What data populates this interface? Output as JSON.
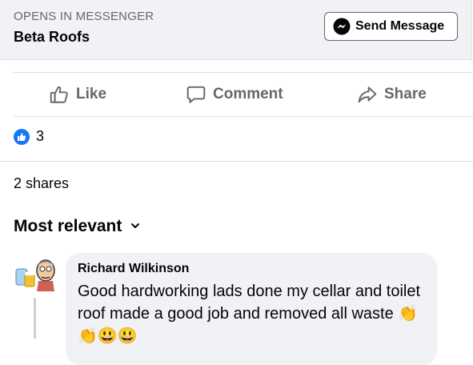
{
  "ad": {
    "opens_in": "OPENS IN MESSENGER",
    "page_name": "Beta Roofs",
    "send_label": "Send Message"
  },
  "actions": {
    "like": "Like",
    "comment": "Comment",
    "share": "Share"
  },
  "reactions": {
    "count": "3"
  },
  "shares": {
    "text": "2 shares"
  },
  "sort": {
    "label": "Most relevant"
  },
  "comment": {
    "author": "Richard Wilkinson",
    "text": "Good hardworking lads done my cellar and toilet roof made a good job and removed all waste 👏👏😃😃"
  },
  "colors": {
    "accent": "#1877f2",
    "muted": "#65676b",
    "bubble": "#f0f2f5"
  },
  "icons": [
    "messenger-icon",
    "like-icon",
    "comment-icon",
    "share-icon",
    "chevron-down-icon"
  ]
}
